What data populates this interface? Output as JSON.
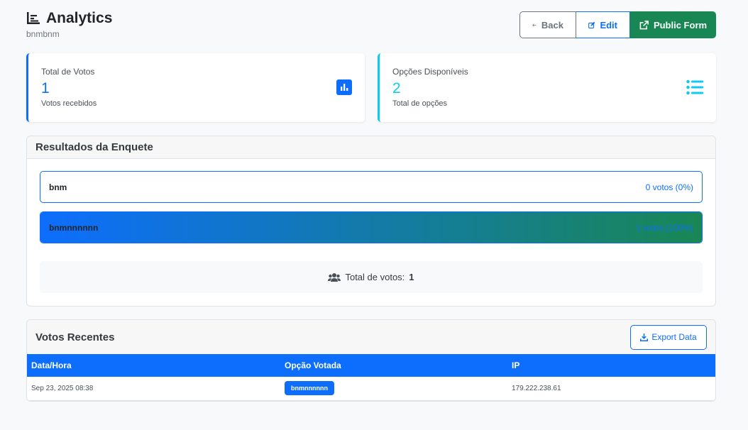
{
  "header": {
    "title": "Analytics",
    "subtitle": "bnmbnm",
    "buttons": {
      "back": "Back",
      "edit": "Edit",
      "public_form": "Public Form"
    }
  },
  "stats": {
    "total_votes": {
      "label": "Total de Votos",
      "value": "1",
      "sub": "Votos recebidos",
      "icon": "bar-chart-icon",
      "color": "#0d6efd"
    },
    "options": {
      "label": "Opções Disponíveis",
      "value": "2",
      "sub": "Total de opções",
      "icon": "list-icon",
      "color": "#0dcaf0"
    }
  },
  "results": {
    "title": "Resultados da Enquete",
    "options": [
      {
        "name": "bnm",
        "votes_text": "0 votos (0%)",
        "percent": 0
      },
      {
        "name": "bnmnnnnnn",
        "votes_text": "1 votos (100%)",
        "percent": 100
      }
    ],
    "total_label": "Total de votos:",
    "total_value": "1"
  },
  "recent": {
    "title": "Votos Recentes",
    "export_label": "Export Data",
    "columns": [
      "Data/Hora",
      "Opção Votada",
      "IP"
    ],
    "rows": [
      {
        "datetime": "Sep 23, 2025 08:38",
        "option": "bnmnnnnnn",
        "ip": "179.222.238.61"
      }
    ]
  },
  "colors": {
    "primary": "#0d6efd",
    "success": "#198754",
    "info": "#0dcaf0",
    "secondary": "#6c757d"
  }
}
